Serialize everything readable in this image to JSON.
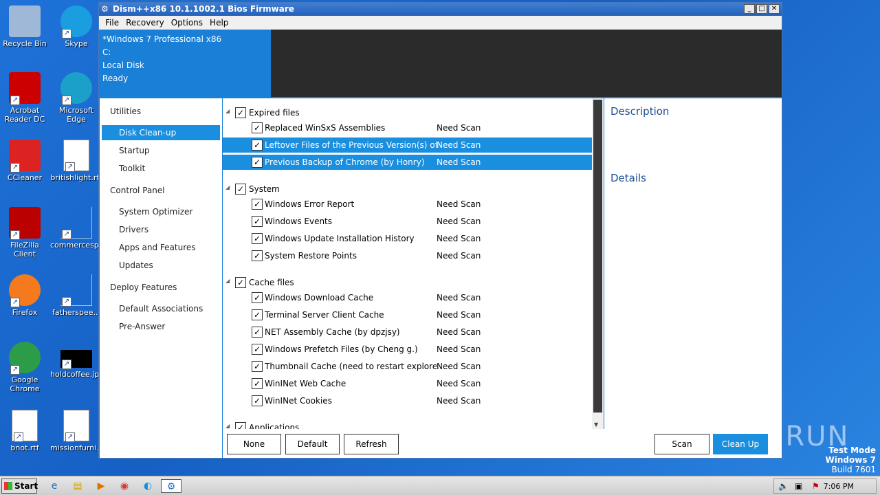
{
  "desktop": {
    "icons": [
      {
        "label": "Recycle Bin",
        "icon": "recycle-bin-icon"
      },
      {
        "label": "Skype",
        "icon": "skype-icon"
      },
      {
        "label": "Acrobat Reader DC",
        "icon": "acrobat-icon"
      },
      {
        "label": "Microsoft Edge",
        "icon": "edge-icon"
      },
      {
        "label": "CCleaner",
        "icon": "ccleaner-icon"
      },
      {
        "label": "britishlight.rtf",
        "icon": "word-doc-icon"
      },
      {
        "label": "FileZilla Client",
        "icon": "filezilla-icon"
      },
      {
        "label": "commercesp...",
        "icon": "blank-file-icon"
      },
      {
        "label": "Firefox",
        "icon": "firefox-icon"
      },
      {
        "label": "fatherspee...",
        "icon": "blank-file-icon"
      },
      {
        "label": "Google Chrome",
        "icon": "chrome-icon"
      },
      {
        "label": "holdcoffee.jpg",
        "icon": "image-file-icon"
      },
      {
        "label": "bnot.rtf",
        "icon": "word-doc-icon"
      },
      {
        "label": "missionfurni...",
        "icon": "word-doc-icon"
      }
    ]
  },
  "window": {
    "title": "Dism++x86 10.1.1002.1 Bios Firmware",
    "menu": [
      "File",
      "Recovery",
      "Options",
      "Help"
    ],
    "info": [
      "*Windows 7 Professional x86",
      "C:",
      "Local Disk",
      "Ready"
    ]
  },
  "nav": {
    "utilities": "Utilities",
    "disk_cleanup": "Disk Clean-up",
    "startup": "Startup",
    "toolkit": "Toolkit",
    "control_panel": "Control Panel",
    "system_optimizer": "System Optimizer",
    "drivers": "Drivers",
    "apps_features": "Apps and Features",
    "updates": "Updates",
    "deploy_features": "Deploy Features",
    "default_assoc": "Default Associations",
    "pre_answer": "Pre-Answer"
  },
  "list": {
    "groups": [
      {
        "label": "Expired files",
        "checked": true,
        "items": [
          {
            "label": "Replaced WinSxS Assemblies",
            "status": "Need Scan",
            "checked": true,
            "selected": false
          },
          {
            "label": "Leftover Files of the Previous Version(s) of Dism",
            "status": "Need Scan",
            "checked": true,
            "selected": true
          },
          {
            "label": "Previous Backup of Chrome (by Honry)",
            "status": "Need Scan",
            "checked": true,
            "selected": true
          }
        ]
      },
      {
        "label": "System",
        "checked": true,
        "items": [
          {
            "label": "Windows Error Report",
            "status": "Need Scan",
            "checked": true,
            "selected": false
          },
          {
            "label": "Windows Events",
            "status": "Need Scan",
            "checked": true,
            "selected": false
          },
          {
            "label": "Windows Update Installation History",
            "status": "Need Scan",
            "checked": true,
            "selected": false
          },
          {
            "label": "System Restore Points",
            "status": "Need Scan",
            "checked": true,
            "selected": false
          }
        ]
      },
      {
        "label": "Cache files",
        "checked": true,
        "items": [
          {
            "label": "Windows Download Cache",
            "status": "Need Scan",
            "checked": true,
            "selected": false
          },
          {
            "label": "Terminal Server Client Cache",
            "status": "Need Scan",
            "checked": true,
            "selected": false
          },
          {
            "label": "NET Assembly Cache (by dpzjsy)",
            "status": "Need Scan",
            "checked": true,
            "selected": false
          },
          {
            "label": "Windows Prefetch Files (by Cheng g.)",
            "status": "Need Scan",
            "checked": true,
            "selected": false
          },
          {
            "label": "Thumbnail Cache (need to restart explorer)",
            "status": "Need Scan",
            "checked": true,
            "selected": false
          },
          {
            "label": "WinINet Web Cache",
            "status": "Need Scan",
            "checked": true,
            "selected": false
          },
          {
            "label": "WinINet Cookies",
            "status": "Need Scan",
            "checked": true,
            "selected": false
          }
        ]
      },
      {
        "label": "Applications",
        "checked": true,
        "items": []
      }
    ]
  },
  "desc": {
    "description": "Description",
    "details": "Details"
  },
  "buttons": {
    "none": "None",
    "default": "Default",
    "refresh": "Refresh",
    "scan": "Scan",
    "cleanup": "Clean Up"
  },
  "watermark": "ANY RUN",
  "testmode": {
    "line1": "Test Mode",
    "line2": "Windows 7",
    "line3": "Build 7601"
  },
  "taskbar": {
    "start": "Start",
    "clock": "7:06 PM"
  },
  "colors": {
    "accent": "#1a8fe0",
    "info_bg": "#1a7fd6",
    "dark_panel": "#2b2b2b"
  }
}
